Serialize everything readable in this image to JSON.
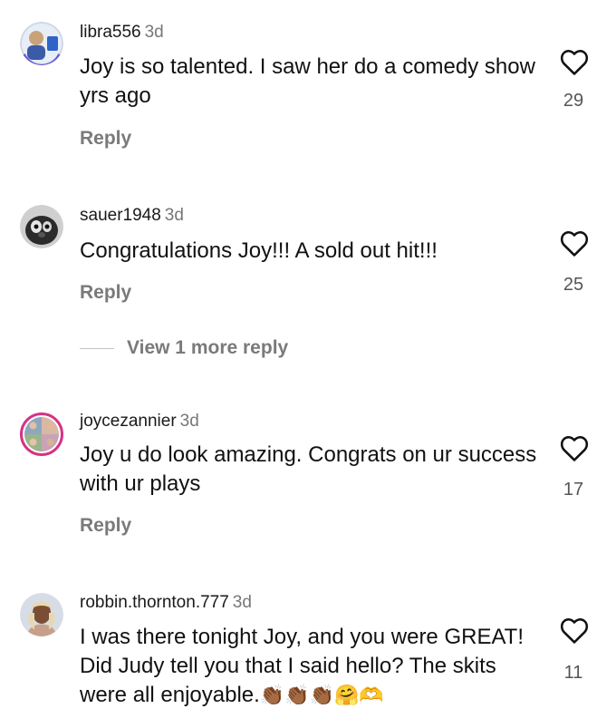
{
  "comments": [
    {
      "username": "libra556",
      "time": "3d",
      "text": "Joy is so talented. I saw her do a comedy show yrs ago",
      "reply_label": "Reply",
      "likes": "29"
    },
    {
      "username": "sauer1948",
      "time": "3d",
      "text": "Congratulations Joy!!! A sold out hit!!!",
      "reply_label": "Reply",
      "likes": "25",
      "view_more": "View 1 more reply"
    },
    {
      "username": "joycezannier",
      "time": "3d",
      "text": "Joy u do look amazing. Congrats on ur success with ur plays",
      "reply_label": "Reply",
      "likes": "17"
    },
    {
      "username": "robbin.thornton.777",
      "time": "3d",
      "text": "I was there tonight Joy, and you were GREAT! Did Judy tell you that I said hello? The skits were all enjoyable.",
      "emojis": "👏🏾👏🏾👏🏾🤗🫶",
      "likes": "11"
    }
  ],
  "colors": {
    "story_ring": "#d63384",
    "secondary_text": "#777777",
    "primary_text": "#111111"
  },
  "icons": [
    "heart-outline-icon"
  ]
}
